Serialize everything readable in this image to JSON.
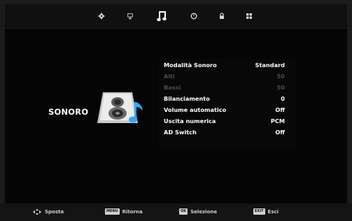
{
  "tabs": [
    {
      "icon": "gear-icon",
      "active": false
    },
    {
      "icon": "monitor-icon",
      "active": false
    },
    {
      "icon": "music-note-icon",
      "active": true
    },
    {
      "icon": "clock-icon",
      "active": false
    },
    {
      "icon": "lock-icon",
      "active": false
    },
    {
      "icon": "grid-icon",
      "active": false
    }
  ],
  "section_title": "SONORO",
  "menu": [
    {
      "label": "Modalità Sonoro",
      "value": "Standard",
      "enabled": true
    },
    {
      "label": "Alti",
      "value": "50",
      "enabled": false
    },
    {
      "label": "Bassi",
      "value": "50",
      "enabled": false
    },
    {
      "label": "Bilanciamento",
      "value": "0",
      "enabled": true
    },
    {
      "label": "Volume automatico",
      "value": "Off",
      "enabled": true
    },
    {
      "label": "Uscita numerica",
      "value": "PCM",
      "enabled": true
    },
    {
      "label": "AD Switch",
      "value": "Off",
      "enabled": true
    }
  ],
  "footer": {
    "move_label": "Sposta",
    "menu_key": "MENU",
    "back_label": "Ritorna",
    "ok_key": "OK",
    "select_label": "Selezione",
    "exit_key": "EXIT",
    "exit_label": "Esci"
  },
  "colors": {
    "background": "#050505",
    "text": "#ffffff",
    "disabled_text": "#4c4c4c",
    "speaker_accent": "#2fa8ff"
  }
}
